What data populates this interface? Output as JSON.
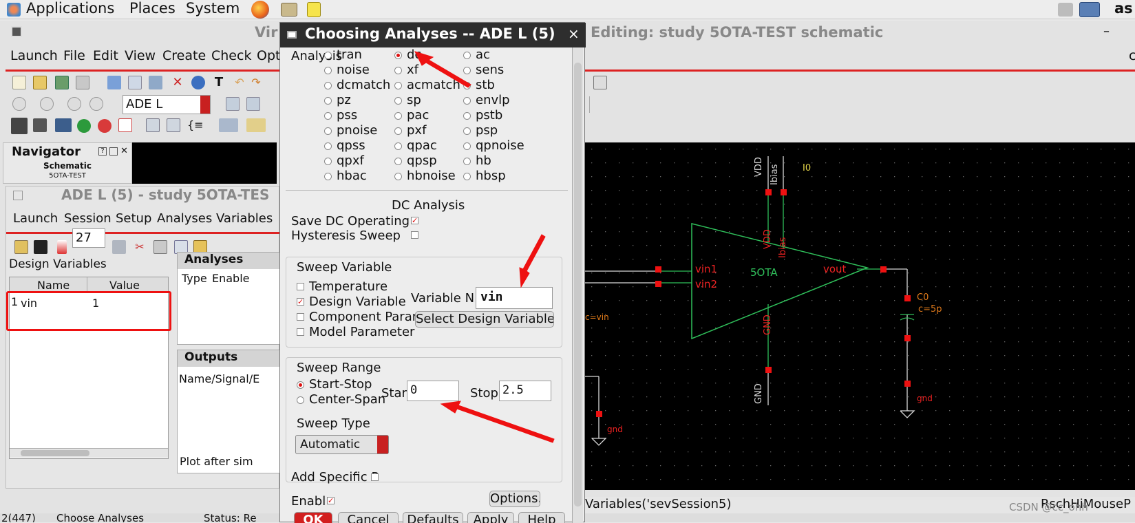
{
  "topbar": {
    "apps": "Applications",
    "places": "Places",
    "system": "System",
    "user": "as"
  },
  "window": {
    "title_left": "Vir",
    "title_right": "Editing: study 5OTA-TEST schematic",
    "min": "–",
    "close_hint": "c"
  },
  "menubar": {
    "launch": "Launch",
    "file": "File",
    "edit": "Edit",
    "view": "View",
    "create": "Create",
    "check": "Check",
    "options": "Opt"
  },
  "toolbar": {
    "mode": "ADE L"
  },
  "navigator": {
    "title": "Navigator",
    "type": "Schematic",
    "cell": "5OTA-TEST"
  },
  "ade": {
    "title": "ADE L (5) - study 5OTA-TES",
    "menu": {
      "launch": "Launch",
      "session": "Session",
      "setup": "Setup",
      "analyses": "Analyses",
      "variables": "Variables"
    },
    "temp": "27",
    "design_vars_label": "Design Variables",
    "col_name": "Name",
    "col_value": "Value",
    "rows": [
      {
        "idx": "1",
        "name": "vin",
        "value": "1"
      }
    ],
    "analyses_label": "Analyses",
    "an_col_type": "Type",
    "an_col_enable": "Enable",
    "outputs_label": "Outputs",
    "out_col": "Name/Signal/E",
    "plot_after": "Plot after sim"
  },
  "dialog": {
    "title": "Choosing Analyses -- ADE L (5)",
    "close": "×",
    "analysis_label": "Analysis",
    "analyses": [
      [
        "tran",
        "dc",
        "ac"
      ],
      [
        "noise",
        "xf",
        "sens"
      ],
      [
        "dcmatch",
        "acmatch",
        "stb"
      ],
      [
        "pz",
        "sp",
        "envlp"
      ],
      [
        "pss",
        "pac",
        "pstb"
      ],
      [
        "pnoise",
        "pxf",
        "psp"
      ],
      [
        "qpss",
        "qpac",
        "qpnoise"
      ],
      [
        "qpxf",
        "qpsp",
        "hb"
      ],
      [
        "hbac",
        "hbnoise",
        "hbsp"
      ]
    ],
    "selected": "dc",
    "section": "DC Analysis",
    "save_dc": "Save DC Operating",
    "hysteresis": "Hysteresis Sweep",
    "sweep_var_label": "Sweep Variable",
    "sv_options": [
      "Temperature",
      "Design Variable",
      "Component Parameter",
      "Model Parameter"
    ],
    "var_name_label": "Variable N",
    "var_name": "vin",
    "select_btn": "Select Design Variable",
    "range_label": "Sweep Range",
    "start_stop": "Start-Stop",
    "center_span": "Center-Span",
    "start_label": "Start",
    "start": "0",
    "stop_label": "Stop",
    "stop": "2.5",
    "sweep_type_label": "Sweep Type",
    "sweep_type": "Automatic",
    "add_specific": "Add Specific P",
    "enable": "Enabl",
    "options_btn": "Options...",
    "buttons": [
      "OK",
      "Cancel",
      "Defaults",
      "Apply",
      "Help"
    ]
  },
  "schematic": {
    "vdd": "VDD",
    "ibias": "Ibias",
    "i0": "I0",
    "vin1": "vin1",
    "vin2": "vin2",
    "block": "5OTA",
    "vout": "vout",
    "vdd_pin": "VDD",
    "ibias_pin": "Ibias",
    "gnd_pin": "GND",
    "gnd": "GND",
    "c0": "C0",
    "cval": "c=5p",
    "gnd1": "gnd",
    "gnd2": "gnd",
    "cvin": "c=vin"
  },
  "statusbar": {
    "cmd": "Variables('sevSession5)",
    "right": "RschHiMouseP",
    "left1": "2(447)",
    "left2": "Choose Analyses",
    "left3": "Status: Re",
    "watermark": "CSDN @cc_ohh"
  },
  "colors": {
    "accent_red": "#dd2222",
    "schematic_green": "#2fbf5a",
    "pin_red": "#ee1111",
    "label_orange": "#e07a1a"
  }
}
